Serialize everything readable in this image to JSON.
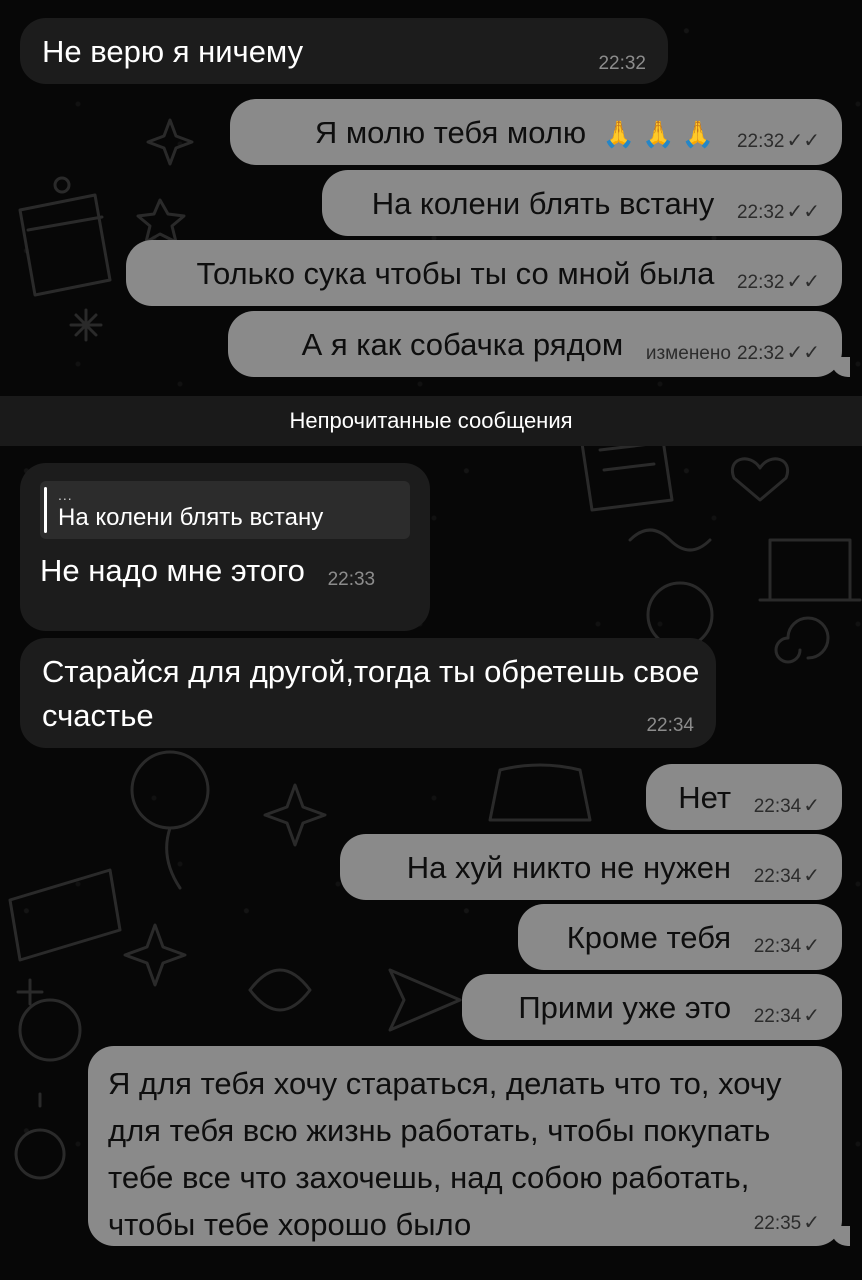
{
  "chat": {
    "unread_banner": "Непрочитанные сообщения",
    "messages": [
      {
        "text": "Не верю я ничему",
        "time": "22:32"
      },
      {
        "text": "Я молю тебя молю",
        "emoji": "🙏 🙏 🙏",
        "time": "22:32",
        "status": "read"
      },
      {
        "text": "На колени блять встану",
        "time": "22:32",
        "status": "read"
      },
      {
        "text": "Только сука чтобы ты со мной была",
        "time": "22:32",
        "status": "read"
      },
      {
        "text": "А я как собачка рядом",
        "edited": "изменено",
        "time": "22:32",
        "status": "read"
      },
      {
        "reply_dots": "...",
        "reply_text": "На колени блять встану",
        "text": "Не надо мне этого",
        "time": "22:33"
      },
      {
        "text": "Старайся для другой,тогда ты обретешь свое счастье",
        "time": "22:34"
      },
      {
        "text": "Нет",
        "time": "22:34",
        "status": "sent"
      },
      {
        "text": "На хуй никто не нужен",
        "time": "22:34",
        "status": "sent"
      },
      {
        "text": "Кроме тебя",
        "time": "22:34",
        "status": "sent"
      },
      {
        "text": "Прими уже это",
        "time": "22:34",
        "status": "sent"
      },
      {
        "text": "Я для тебя хочу стараться, делать что то, хочу для тебя всю жизнь работать, чтобы покупать тебе все что захочешь, над собою работать, чтобы тебе хорошо было",
        "time": "22:35",
        "status": "sent"
      }
    ],
    "check_single": "✓",
    "check_double": "✓✓",
    "wallpaper": "doodle-pattern",
    "colors": {
      "incoming_bubble": "#1c1c1c",
      "outgoing_bubble": "#8a8a8a",
      "background": "#070707",
      "banner": "#1a1a1a"
    }
  }
}
